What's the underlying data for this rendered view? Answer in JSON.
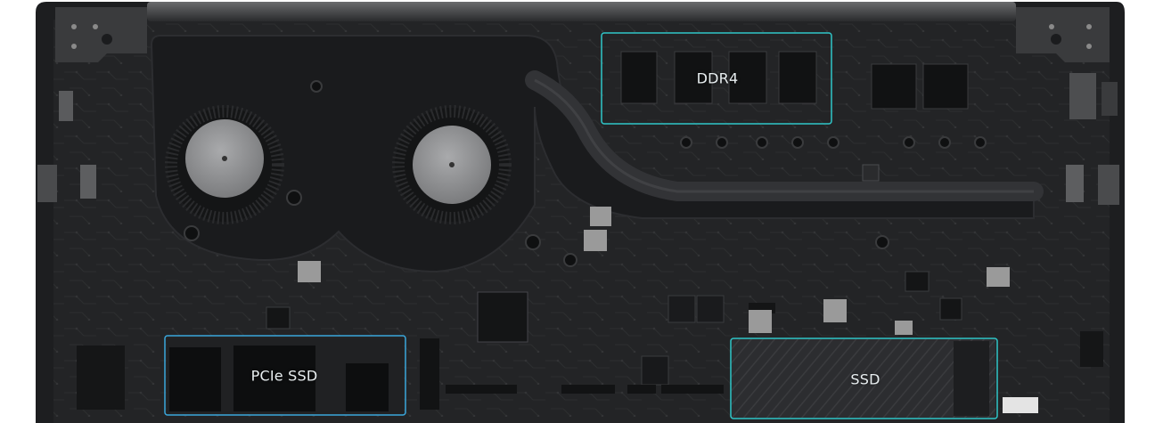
{
  "image": {
    "subject": "laptop motherboard top-down view",
    "colors": {
      "background": "#ffffff",
      "chassis": "#1d1e20",
      "board": "#252628",
      "fan_housing": "#1a1b1d",
      "fan_hub": "#8c8d8f",
      "component_light": "#9a9a9a",
      "callout_teal": "#2fc6c9",
      "callout_blue": "#3aa7dc"
    }
  },
  "callouts": {
    "ddr4": {
      "label": "DDR4",
      "color": "#2fc6c9"
    },
    "pcie_ssd": {
      "label": "PCIe SSD",
      "color": "#3aa7dc"
    },
    "ssd": {
      "label": "SSD",
      "color": "#2fc6c9"
    }
  }
}
